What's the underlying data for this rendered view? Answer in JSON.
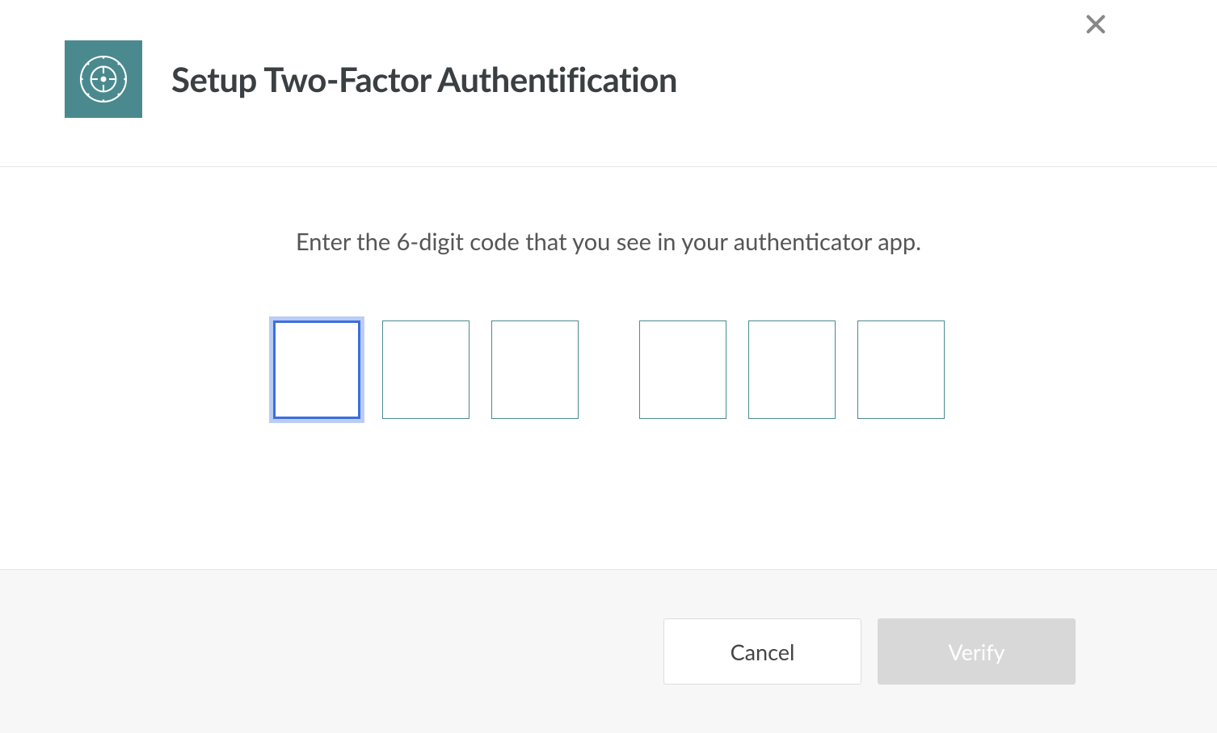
{
  "modal": {
    "title": "Setup Two-Factor Authentification",
    "instruction": "Enter the 6-digit code that you see in your authenticator app.",
    "code_inputs": {
      "count": 6,
      "focused_index": 0,
      "values": [
        "",
        "",
        "",
        "",
        "",
        ""
      ]
    }
  },
  "footer": {
    "cancel_label": "Cancel",
    "verify_label": "Verify",
    "verify_disabled": true
  }
}
